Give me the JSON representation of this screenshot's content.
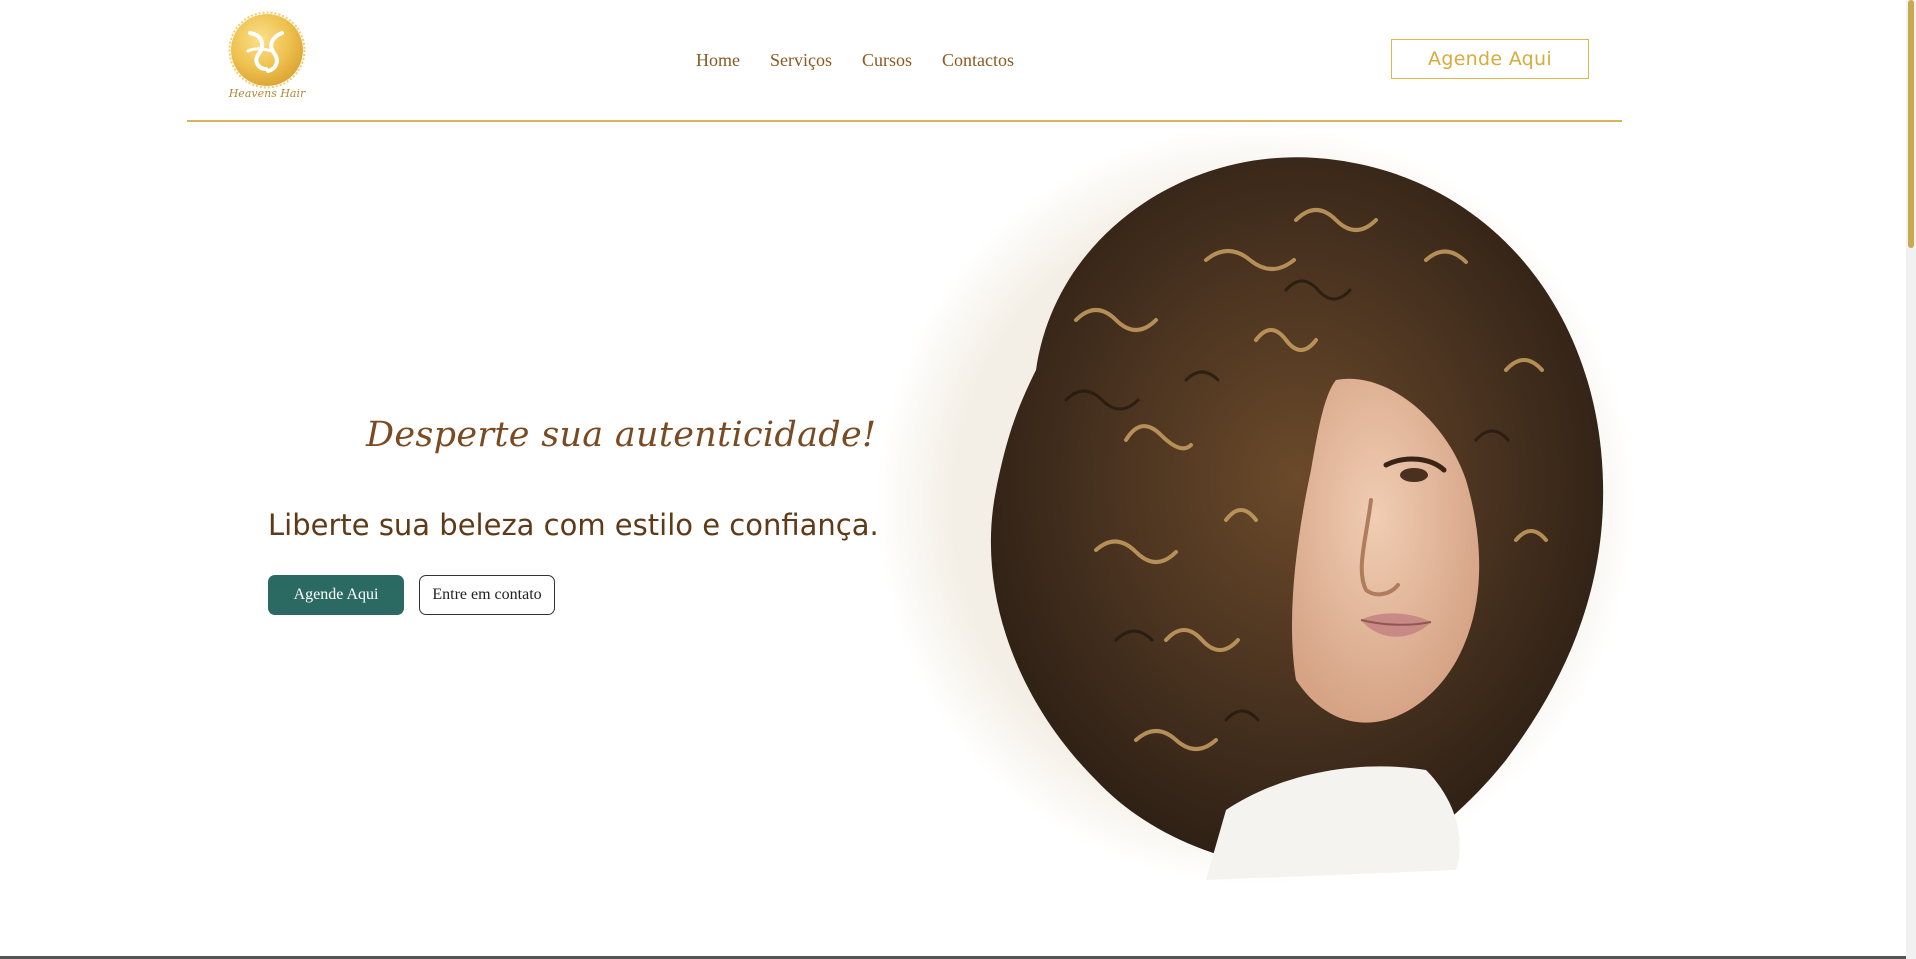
{
  "header": {
    "brand_name": "Heavens Hair",
    "nav": [
      "Home",
      "Serviços",
      "Cursos",
      "Contactos"
    ],
    "cta_label": "Agende Aqui"
  },
  "hero": {
    "tagline": "Desperte sua autenticidade!",
    "headline": "Liberte sua beleza com estilo e confiança.",
    "primary_button": "Agende Aqui",
    "secondary_button": "Entre em contato"
  },
  "colors": {
    "gold": "#d9aa3c",
    "brown": "#7a4a22",
    "teal": "#2a6a62"
  },
  "icons": {
    "logo": "heavens-hair-logo-icon"
  }
}
